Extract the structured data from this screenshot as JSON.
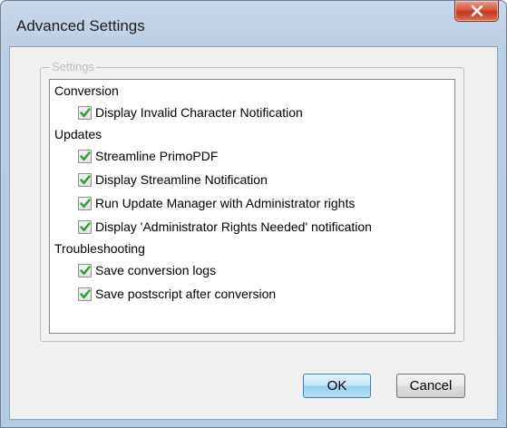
{
  "window": {
    "title": "Advanced Settings",
    "close_icon": "close-x-icon"
  },
  "settings": {
    "group_label": "Settings",
    "sections": [
      {
        "label": "Conversion",
        "options": [
          {
            "label": "Display Invalid Character Notification",
            "checked": true
          }
        ]
      },
      {
        "label": "Updates",
        "options": [
          {
            "label": "Streamline PrimoPDF",
            "checked": true
          },
          {
            "label": "Display Streamline Notification",
            "checked": true
          },
          {
            "label": "Run Update Manager with Administrator rights",
            "checked": true
          },
          {
            "label": "Display 'Administrator Rights Needed' notification",
            "checked": true
          }
        ]
      },
      {
        "label": "Troubleshooting",
        "options": [
          {
            "label": "Save conversion logs",
            "checked": true
          },
          {
            "label": "Save postscript after conversion",
            "checked": true
          }
        ]
      }
    ]
  },
  "buttons": {
    "ok_label": "OK",
    "cancel_label": "Cancel"
  },
  "colors": {
    "checkmark": "#2f9c2a",
    "title_bar": "#b9cde4",
    "close_button": "#c0391c"
  }
}
